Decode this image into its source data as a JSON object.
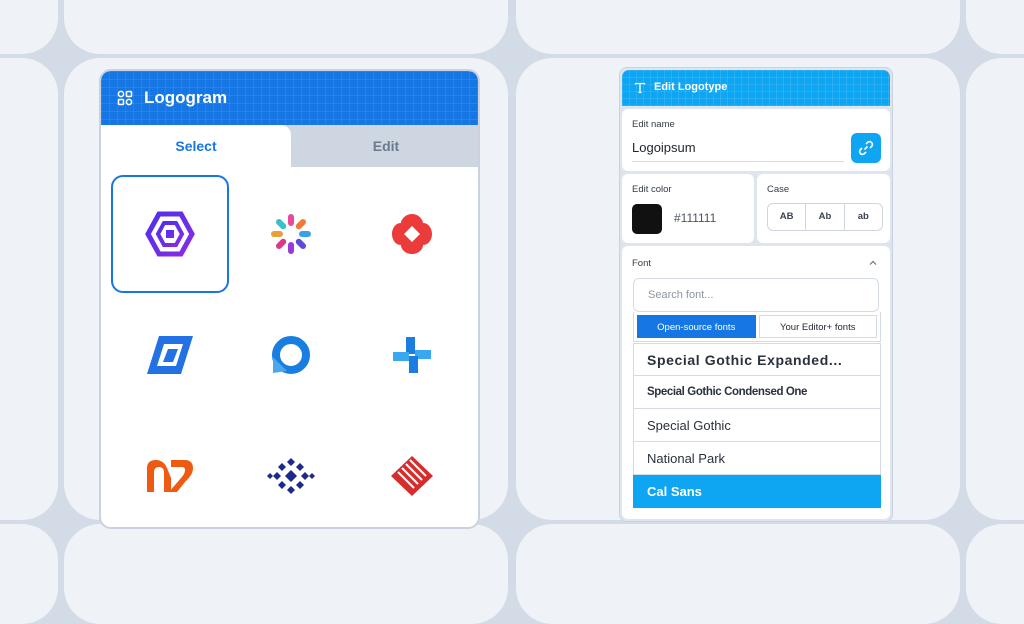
{
  "colors": {
    "logogram_accent": "#1677e4",
    "logotype_accent": "#0ea5f2",
    "selected_color": "#111111"
  },
  "logogram": {
    "title": "Logogram",
    "tabs": [
      {
        "label": "Select"
      },
      {
        "label": "Edit"
      }
    ],
    "logos": [
      "hexagon-spiral-logo",
      "flower-burst-logo",
      "red-diamond-petal-logo",
      "blue-parallelogram-logo",
      "blue-ring-logo",
      "blue-plus-logo",
      "orange-wave-logo",
      "navy-snowflake-logo",
      "red-chevron-stripes-logo"
    ]
  },
  "logotype": {
    "title": "Edit Logotype",
    "name_label": "Edit name",
    "name_value": "Logoipsum",
    "color_label": "Edit color",
    "color_hex": "#111111",
    "case_label": "Case",
    "case_options": [
      "AB",
      "Ab",
      "ab"
    ],
    "font_label": "Font",
    "search_placeholder": "Search font...",
    "font_tabs": [
      "Open-source fonts",
      "Your Editor+ fonts"
    ],
    "fonts": [
      "Special Gothic Expanded...",
      "Special Gothic Condensed One",
      "Special Gothic",
      "National Park",
      "Cal Sans"
    ]
  }
}
